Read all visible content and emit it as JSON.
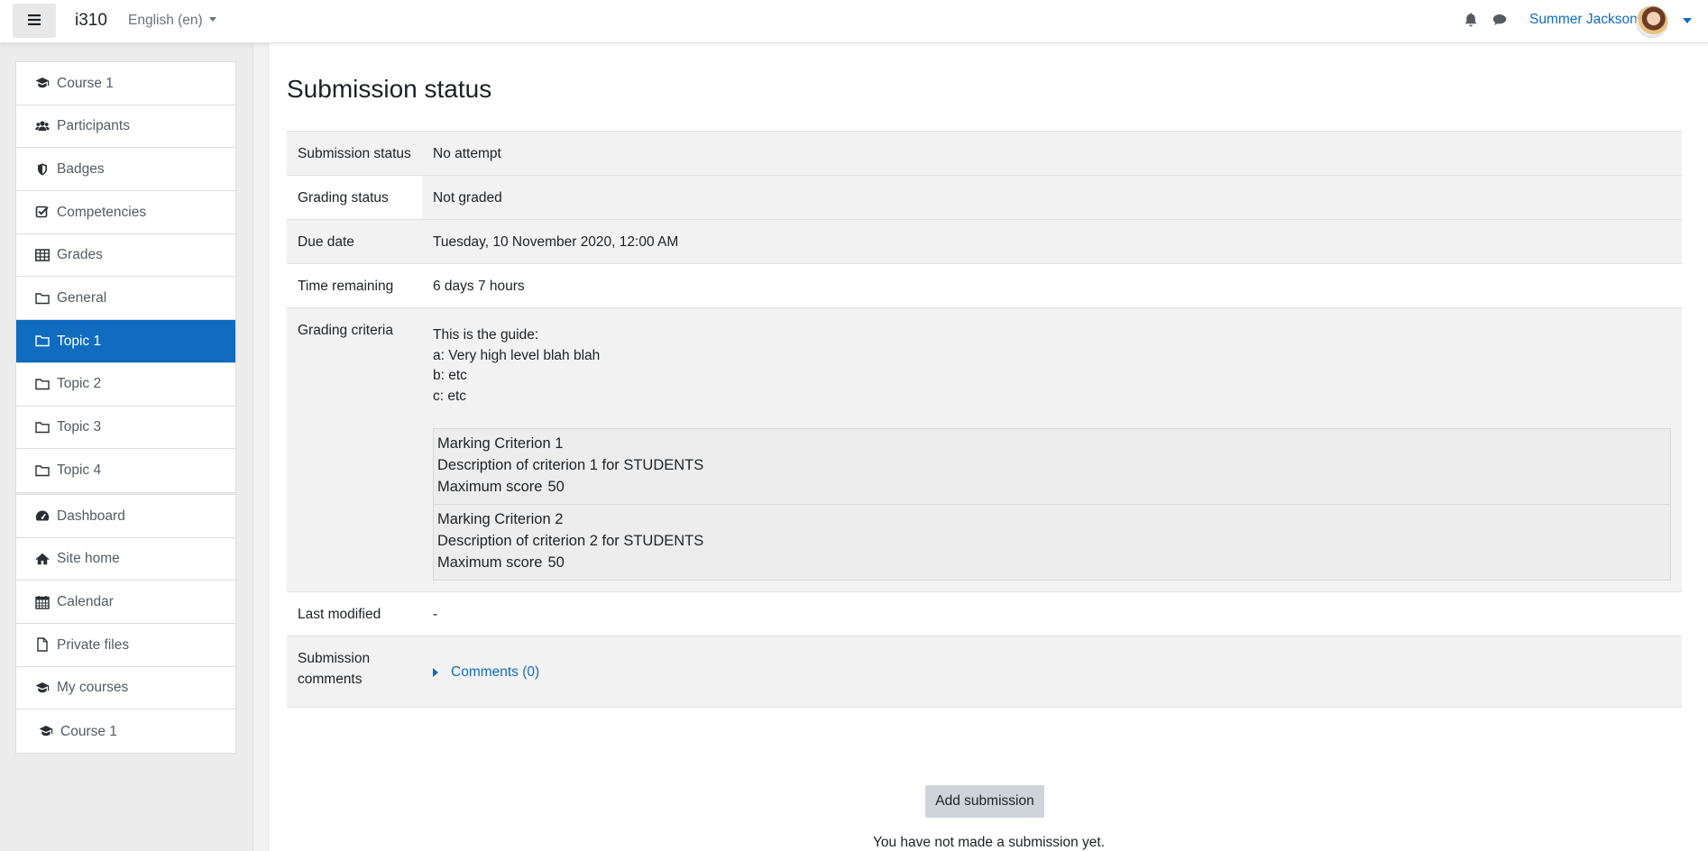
{
  "navbar": {
    "site_name": "i310",
    "language": "English (en)",
    "user_name": "Summer Jackson",
    "icons": [
      "menu-icon",
      "bell-icon",
      "chat-icon",
      "avatar",
      "chevron-down-icon"
    ]
  },
  "sidebar": {
    "course_nav": [
      {
        "label": "Course 1",
        "icon": "graduation-cap-icon"
      },
      {
        "label": "Participants",
        "icon": "users-icon"
      },
      {
        "label": "Badges",
        "icon": "shield-icon"
      },
      {
        "label": "Competencies",
        "icon": "checkbox-icon"
      },
      {
        "label": "Grades",
        "icon": "table-icon"
      },
      {
        "label": "General",
        "icon": "folder-icon"
      },
      {
        "label": "Topic 1",
        "icon": "folder-icon",
        "active": true
      },
      {
        "label": "Topic 2",
        "icon": "folder-icon"
      },
      {
        "label": "Topic 3",
        "icon": "folder-icon"
      },
      {
        "label": "Topic 4",
        "icon": "folder-icon"
      }
    ],
    "site_nav": [
      {
        "label": "Dashboard",
        "icon": "dashboard-icon"
      },
      {
        "label": "Site home",
        "icon": "home-icon"
      },
      {
        "label": "Calendar",
        "icon": "calendar-icon"
      },
      {
        "label": "Private files",
        "icon": "file-icon"
      },
      {
        "label": "My courses",
        "icon": "graduation-cap-icon"
      },
      {
        "label": "Course 1",
        "icon": "graduation-cap-icon"
      }
    ],
    "active_color": "#0f6cbf"
  },
  "main": {
    "title": "Submission status",
    "rows": {
      "submission_status": {
        "label": "Submission status",
        "value": "No attempt"
      },
      "grading_status": {
        "label": "Grading status",
        "value": "Not graded"
      },
      "due_date": {
        "label": "Due date",
        "value": "Tuesday, 10 November 2020, 12:00 AM"
      },
      "time_remaining": {
        "label": "Time remaining",
        "value": "6 days 7 hours"
      },
      "grading_criteria": {
        "label": "Grading criteria",
        "guide_lines": [
          "This is the guide:",
          "a: Very high level blah blah",
          "b: etc",
          "c: etc"
        ],
        "criteria": [
          {
            "name": "Marking Criterion 1",
            "description": "Description of criterion 1 for STUDENTS",
            "max_label": "Maximum score",
            "max_value": "50"
          },
          {
            "name": "Marking Criterion 2",
            "description": "Description of criterion 2 for STUDENTS",
            "max_label": "Maximum score",
            "max_value": "50"
          }
        ]
      },
      "last_modified": {
        "label": "Last modified",
        "value": "-"
      },
      "submission_comments": {
        "label": "Submission comments",
        "link": "Comments (0)"
      }
    },
    "add_submission_button": "Add submission",
    "no_submission_text": "You have not made a submission yet."
  }
}
